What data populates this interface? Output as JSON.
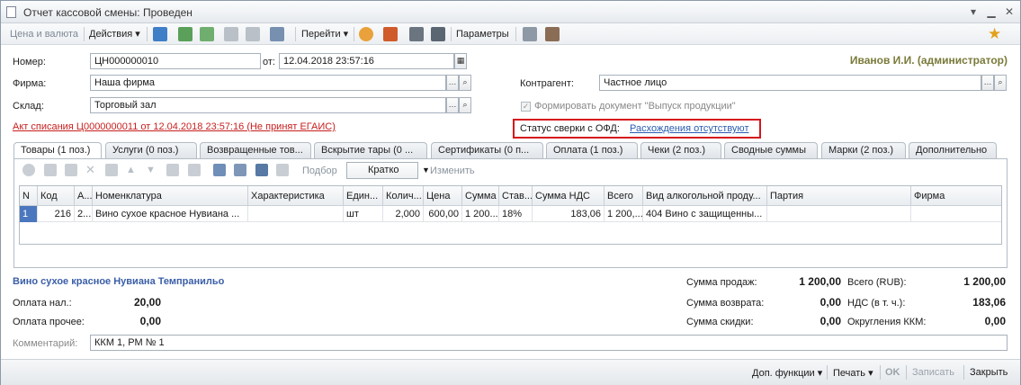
{
  "window": {
    "title": "Отчет кассовой смены: Проведен"
  },
  "toolbar": {
    "price_currency": "Цена и валюта",
    "actions": "Действия",
    "go": "Перейти",
    "params": "Параметры"
  },
  "header": {
    "number_label": "Номер:",
    "number_value": "ЦН000000010",
    "date_label": "от:",
    "date_value": "12.04.2018 23:57:16",
    "user": "Иванов И.И. (администратор)",
    "firm_label": "Фирма:",
    "firm_value": "Наша фирма",
    "warehouse_label": "Склад:",
    "warehouse_value": "Торговый зал",
    "contractor_label": "Контрагент:",
    "contractor_value": "Частное лицо",
    "form_doc_checkbox": "Формировать документ \"Выпуск продукции\"",
    "writeoff_link": "Акт списания Ц0000000011 от 12.04.2018 23:57:16 (Не принят ЕГАИС)",
    "ofd_label": "Статус сверки с ОФД:",
    "ofd_value": "Расхождения отсутствуют"
  },
  "tabs": [
    "Товары (1 поз.)",
    "Услуги (0 поз.)",
    "Возвращенные тов...",
    "Вскрытие тары (0 ...",
    "Сертификаты (0 п...",
    "Оплата (1 поз.)",
    "Чеки (2 поз.)",
    "Сводные суммы",
    "Марки (2 поз.)",
    "Дополнительно"
  ],
  "grid_toolbar": {
    "selection": "Подбор",
    "mode": "Кратко",
    "edit": "Изменить"
  },
  "grid": {
    "columns": [
      "N",
      "Код",
      "А...",
      "Номенклатура",
      "Характеристика",
      "Един...",
      "Колич...",
      "Цена",
      "Сумма",
      "Став...",
      "Сумма НДС",
      "Всего",
      "Вид алкогольной проду...",
      "Партия",
      "Фирма"
    ],
    "rows": [
      [
        "1",
        "216",
        "2...",
        "Вино сухое красное Нувиана ...",
        "",
        "шт",
        "2,000",
        "600,00",
        "1 200...",
        "18%",
        "183,06",
        "1 200,...",
        "404 Вино с защищенны...",
        "",
        ""
      ]
    ]
  },
  "footer": {
    "item_name": "Вино сухое красное Нувиана Темпранильо",
    "cash_label": "Оплата нал.:",
    "cash_value": "20,00",
    "other_label": "Оплата прочее:",
    "other_value": "0,00",
    "sales_label": "Сумма продаж:",
    "sales_value": "1 200,00",
    "return_label": "Сумма возврата:",
    "return_value": "0,00",
    "discount_label": "Сумма скидки:",
    "discount_value": "0,00",
    "total_label": "Всего (RUB):",
    "total_value": "1 200,00",
    "vat_label": "НДС (в т. ч.):",
    "vat_value": "183,06",
    "rounding_label": "Округления ККМ:",
    "rounding_value": "0,00",
    "comment_label": "Комментарий:",
    "comment_value": "ККМ 1, РМ № 1"
  },
  "bottom": {
    "more": "Доп. функции",
    "print": "Печать",
    "ok": "OK",
    "save": "Записать",
    "close": "Закрыть"
  },
  "colors": {
    "accent_red": "#d6151c",
    "link_blue": "#2b5cb1",
    "selection": "#4b77be"
  }
}
